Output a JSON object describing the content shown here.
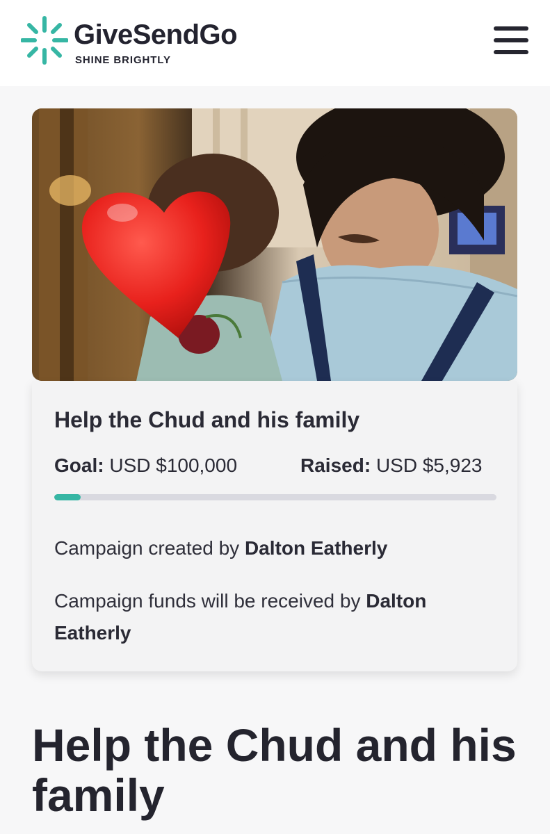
{
  "brand": {
    "name": "GiveSendGo",
    "tagline": "SHINE BRIGHTLY",
    "colors": {
      "teal": "#36b6a4",
      "dark": "#23232f"
    }
  },
  "header": {
    "menu_icon": "hamburger-menu-icon"
  },
  "hero": {
    "image_subject": "photo of a man holding a child, child's face covered by a red heart emoji"
  },
  "campaign": {
    "title": "Help the Chud and his family",
    "goal_label": "Goal:",
    "goal_value": "USD $100,000",
    "raised_label": "Raised:",
    "raised_value": "USD $5,923",
    "progress_percent": 5.9,
    "created_by_prefix": "Campaign created by",
    "created_by_name": "Dalton Eatherly",
    "funds_prefix": "Campaign funds will be received by",
    "funds_name": "Dalton Eatherly"
  },
  "page_title": "Help the Chud and his family"
}
